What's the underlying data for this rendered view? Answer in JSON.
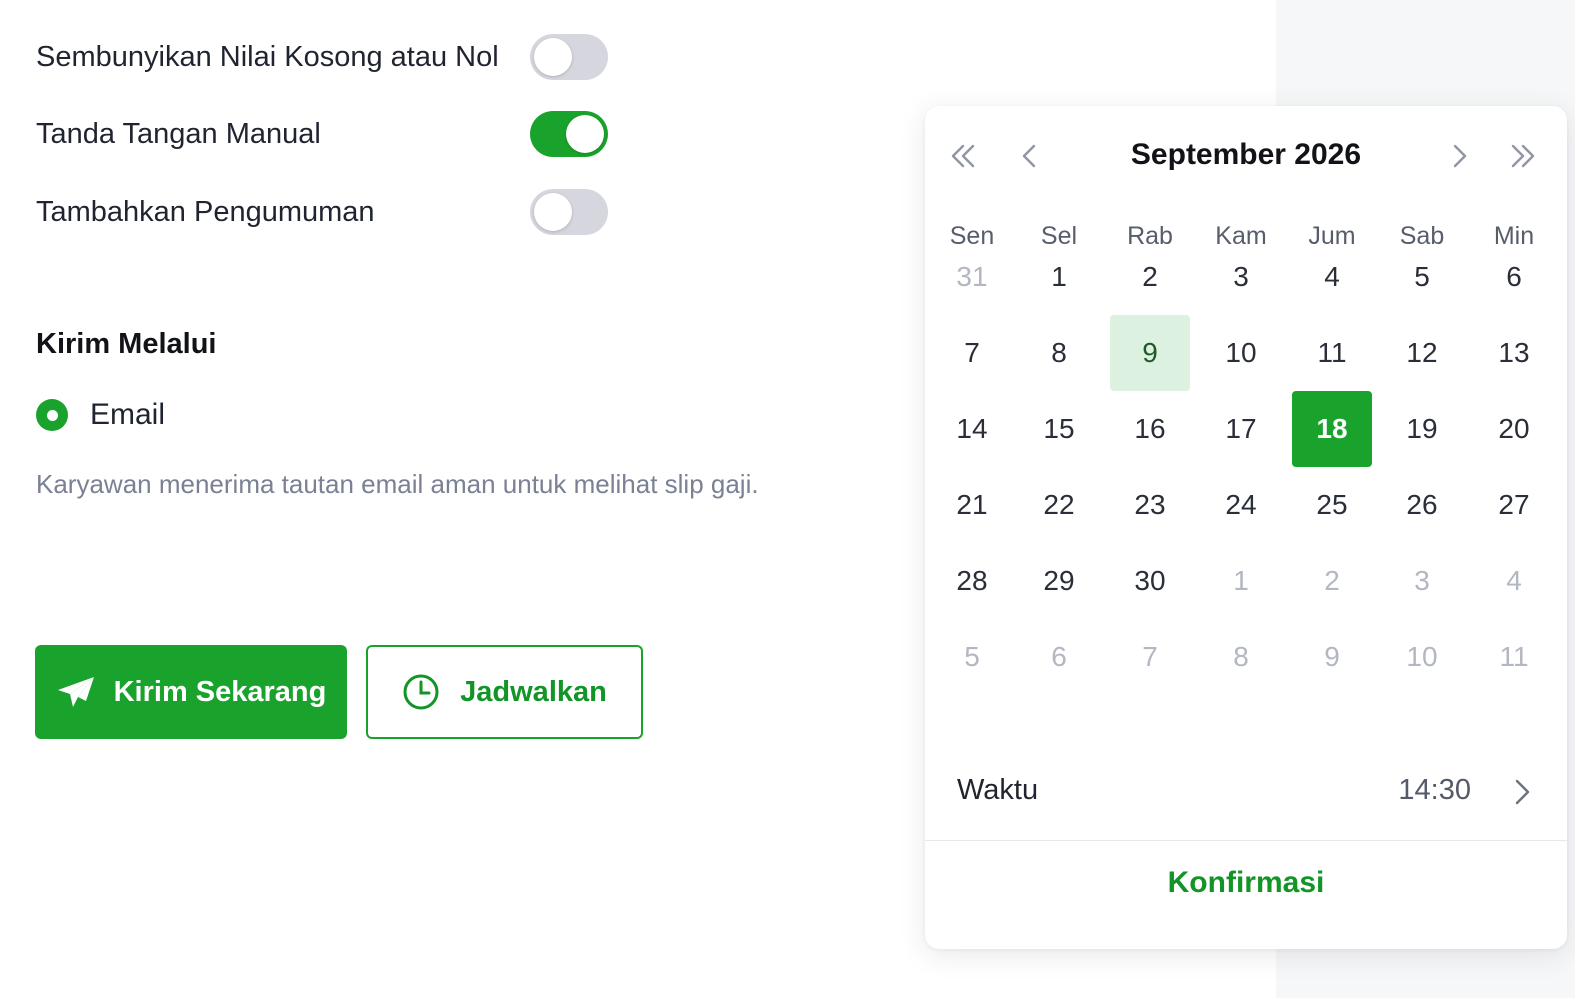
{
  "settings": {
    "toggles": [
      {
        "label": "Sembunyikan Nilai Kosong atau Nol",
        "on": false
      },
      {
        "label": "Tanda Tangan Manual",
        "on": true
      },
      {
        "label": "Tambahkan Pengumuman",
        "on": false
      }
    ]
  },
  "delivery": {
    "title": "Kirim Melalui",
    "option_label": "Email",
    "helper": "Karyawan menerima tautan email aman untuk melihat slip gaji."
  },
  "actions": {
    "send_now": "Kirim Sekarang",
    "schedule": "Jadwalkan"
  },
  "calendar": {
    "title": "September 2026",
    "weekdays": [
      "Sen",
      "Sel",
      "Rab",
      "Kam",
      "Jum",
      "Sab",
      "Min"
    ],
    "weeks": [
      [
        "31",
        "1",
        "2",
        "3",
        "4",
        "5",
        "6"
      ],
      [
        "7",
        "8",
        "9",
        "10",
        "11",
        "12",
        "13"
      ],
      [
        "14",
        "15",
        "16",
        "17",
        "18",
        "19",
        "20"
      ],
      [
        "21",
        "22",
        "23",
        "24",
        "25",
        "26",
        "27"
      ],
      [
        "28",
        "29",
        "30",
        "1",
        "2",
        "3",
        "4"
      ],
      [
        "5",
        "6",
        "7",
        "8",
        "9",
        "10",
        "11"
      ]
    ],
    "today": "9",
    "selected": "18",
    "time_label": "Waktu",
    "time_value": "14:30",
    "confirm": "Konfirmasi"
  },
  "colors": {
    "accent": "#1aa32c",
    "today_bg": "#dcf1df",
    "muted_text": "#b3b7c2"
  }
}
